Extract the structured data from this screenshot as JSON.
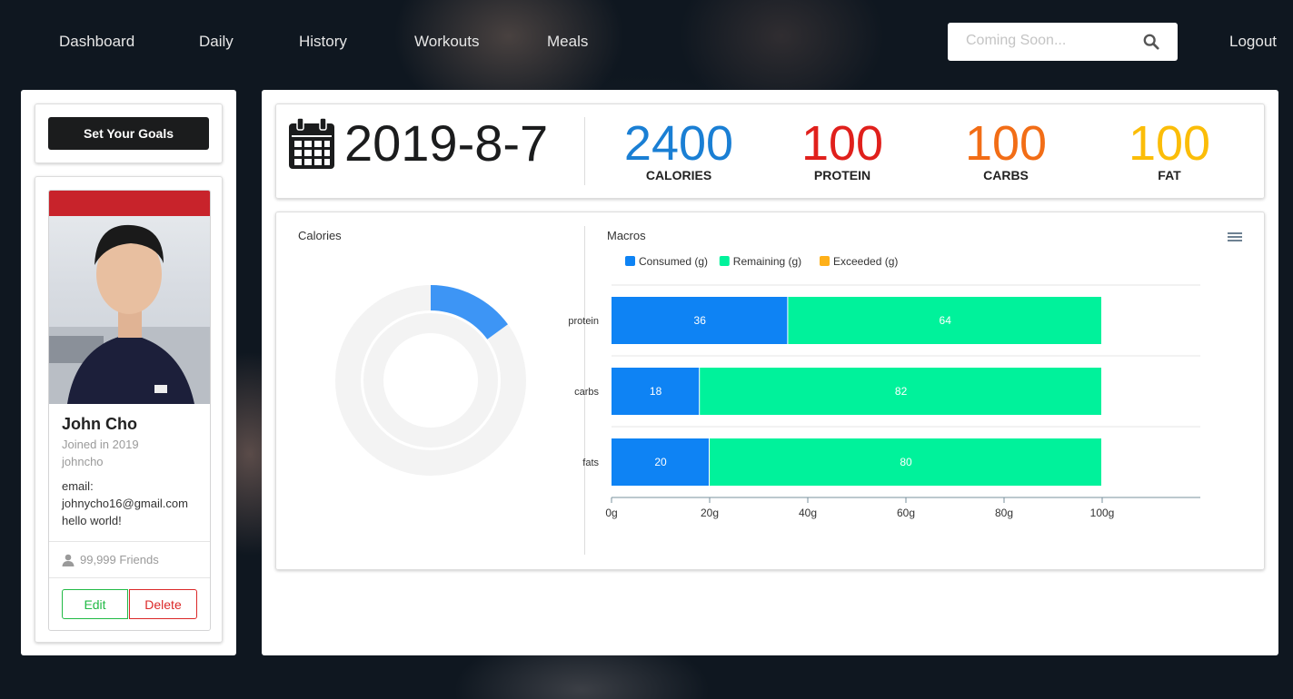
{
  "nav": {
    "links": [
      "Dashboard",
      "Daily",
      "History",
      "Workouts",
      "Meals"
    ],
    "search_placeholder": "Coming Soon...",
    "logout": "Logout"
  },
  "sidebar": {
    "goal_button": "Set Your Goals",
    "profile": {
      "name": "John Cho",
      "joined": "Joined in 2019",
      "username": "johncho",
      "email_label": "email:",
      "email": "johnycho16@gmail.com",
      "bio": "hello world!",
      "friends": "99,999 Friends",
      "edit": "Edit",
      "delete": "Delete"
    }
  },
  "summary": {
    "date": "2019-8-7",
    "stats": [
      {
        "value": "2400",
        "label": "CALORIES",
        "color": "#1a7fd4"
      },
      {
        "value": "100",
        "label": "PROTEIN",
        "color": "#e0201c"
      },
      {
        "value": "100",
        "label": "CARBS",
        "color": "#f26d16"
      },
      {
        "value": "100",
        "label": "FAT",
        "color": "#fbbd08"
      }
    ]
  },
  "chart_data": [
    {
      "type": "pie",
      "title": "Calories",
      "consumed_fraction": 0.15,
      "colors": {
        "consumed": "#3d95f5",
        "remaining": "#f3f3f3"
      }
    },
    {
      "type": "bar",
      "orientation": "horizontal",
      "stacked": true,
      "title": "Macros",
      "categories": [
        "protein",
        "carbs",
        "fats"
      ],
      "series": [
        {
          "name": "Consumed (g)",
          "color": "#0e83f4",
          "values": [
            36,
            18,
            20
          ]
        },
        {
          "name": "Remaining (g)",
          "color": "#00f29b",
          "values": [
            64,
            82,
            80
          ]
        },
        {
          "name": "Exceeded (g)",
          "color": "#feb019",
          "values": [
            0,
            0,
            0
          ]
        }
      ],
      "xticks": [
        "0g",
        "20g",
        "40g",
        "60g",
        "80g",
        "100g"
      ],
      "xlim": [
        0,
        120
      ],
      "legend": "top-left",
      "grid": true
    }
  ]
}
